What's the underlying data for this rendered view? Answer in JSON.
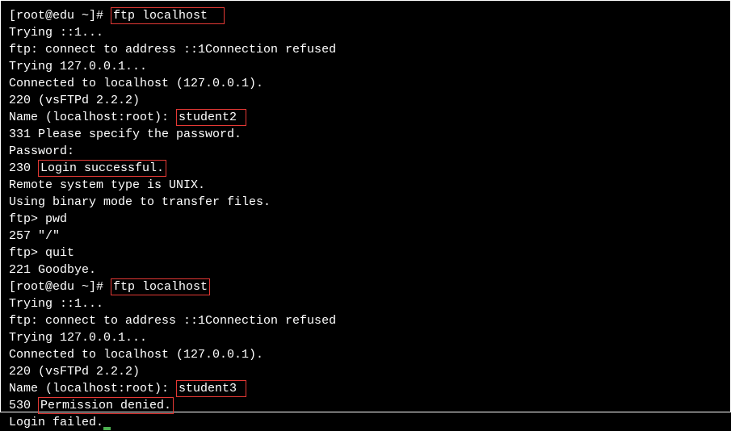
{
  "lines": {
    "l0a": "[root@edu ~]# ",
    "l0b": "ftp localhost  ",
    "l1": "Trying ::1...",
    "l2": "ftp: connect to address ::1Connection refused",
    "l3": "Trying 127.0.0.1...",
    "l4": "Connected to localhost (127.0.0.1).",
    "l5": "220 (vsFTPd 2.2.2)",
    "l6a": "Name (localhost:root): ",
    "l6b": "student2 ",
    "l7": "331 Please specify the password.",
    "l8": "Password:",
    "l9a": "230 ",
    "l9b": "Login successful.",
    "l10": "Remote system type is UNIX.",
    "l11": "Using binary mode to transfer files.",
    "l12": "ftp> pwd",
    "l13": "257 \"/\"",
    "l14": "ftp> quit",
    "l15": "221 Goodbye.",
    "l16a": "[root@edu ~]# ",
    "l16b": "ftp localhost",
    "l17": "Trying ::1...",
    "l18": "ftp: connect to address ::1Connection refused",
    "l19": "Trying 127.0.0.1...",
    "l20": "Connected to localhost (127.0.0.1).",
    "l21": "220 (vsFTPd 2.2.2)",
    "l22a": "Name (localhost:root): ",
    "l22b": "student3 ",
    "l23a": "530 ",
    "l23b": "Permission denied.",
    "l24": "Login failed."
  }
}
